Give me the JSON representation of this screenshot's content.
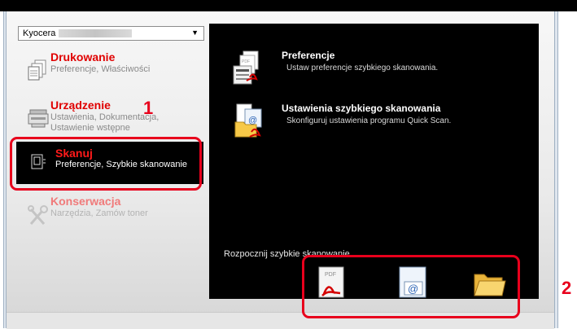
{
  "device": {
    "selected": "Kyocera"
  },
  "sidebar": {
    "items": [
      {
        "title": "Drukowanie",
        "subtitle": "Preferencje, Właściwości"
      },
      {
        "title": "Urządzenie",
        "subtitle": "Ustawienia, Dokumentacja, Ustawienie wstępne"
      },
      {
        "title": "Skanuj",
        "subtitle": "Preferencje, Szybkie skanowanie"
      },
      {
        "title": "Konserwacja",
        "subtitle": "Narzędzia, Zamów toner"
      }
    ]
  },
  "main": {
    "options": [
      {
        "title": "Preferencje",
        "subtitle": "Ustaw preferencje szybkiego skanowania."
      },
      {
        "title": "Ustawienia szybkiego skanowania",
        "subtitle": "Skonfiguruj ustawienia programu Quick Scan."
      }
    ],
    "quick_scan_label": "Rozpocznij szybkie skanowanie",
    "pdf_icon_text": "PDF"
  },
  "callouts": {
    "one": "1",
    "two": "2"
  },
  "colors": {
    "accent": "#e8001c",
    "panel": "#000000",
    "menu_title": "#e00000"
  }
}
